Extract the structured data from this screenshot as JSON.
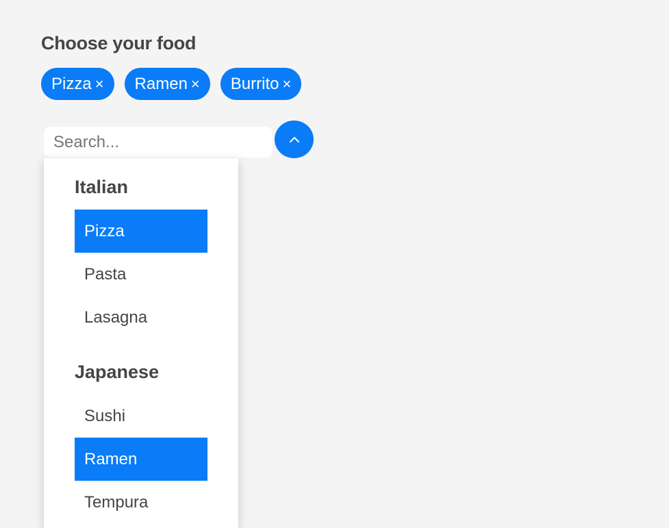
{
  "header": {
    "title": "Choose your food"
  },
  "selected_chips": [
    {
      "label": "Pizza",
      "remove": "×"
    },
    {
      "label": "Ramen",
      "remove": "×"
    },
    {
      "label": "Burrito",
      "remove": "×"
    }
  ],
  "search": {
    "placeholder": "Search...",
    "value": ""
  },
  "toggle": {
    "icon": "chevron-up-icon"
  },
  "dropdown": {
    "groups": [
      {
        "title": "Italian",
        "options": [
          {
            "label": "Pizza",
            "selected": true
          },
          {
            "label": "Pasta",
            "selected": false
          },
          {
            "label": "Lasagna",
            "selected": false
          }
        ]
      },
      {
        "title": "Japanese",
        "options": [
          {
            "label": "Sushi",
            "selected": false
          },
          {
            "label": "Ramen",
            "selected": true
          },
          {
            "label": "Tempura",
            "selected": false
          }
        ]
      }
    ]
  },
  "colors": {
    "accent": "#0a7cf8",
    "background": "#f4f4f4",
    "text": "#454545"
  }
}
